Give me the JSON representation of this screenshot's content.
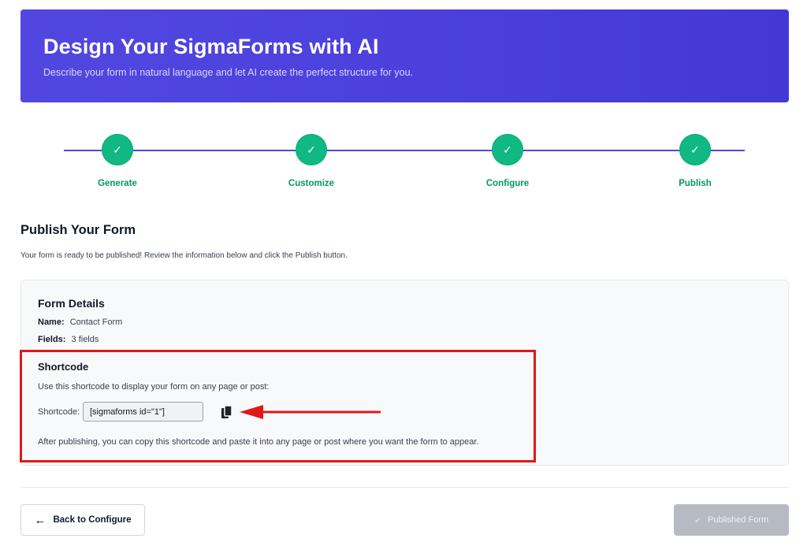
{
  "hero": {
    "title": "Design Your SigmaForms with AI",
    "subtitle": "Describe your form in natural language and let AI create the perfect structure for you."
  },
  "steps": [
    {
      "label": "Generate",
      "status": "completed",
      "icon": "check-icon"
    },
    {
      "label": "Customize",
      "status": "completed",
      "icon": "check-icon"
    },
    {
      "label": "Configure",
      "status": "completed",
      "icon": "check-icon"
    },
    {
      "label": "Publish",
      "status": "completed",
      "icon": "check-icon"
    }
  ],
  "check_glyph": "✓",
  "publish": {
    "title": "Publish Your Form",
    "description": "Your form is ready to be published! Review the information below and click the Publish button."
  },
  "form_details": {
    "title": "Form Details",
    "name_label": "Name:",
    "name_value": "Contact Form",
    "fields_label": "Fields:",
    "fields_value": "3 fields"
  },
  "shortcode": {
    "title": "Shortcode",
    "description": "Use this shortcode to display your form on any page or post:",
    "label": "Shortcode:",
    "value": "[sigmaforms id=\"1\"]",
    "copy_icon": "copy-icon",
    "note": "After publishing, you can copy this shortcode and paste it into any page or post where you want the form to appear."
  },
  "annotation": {
    "highlight_color": "#e01818",
    "arrow_color": "#e01818"
  },
  "buttons": {
    "back_arrow": "←",
    "back_label": "Back to Configure",
    "published_check": "✓",
    "published_label": "Published Form"
  },
  "colors": {
    "hero": "#4f46e5",
    "step_complete": "#10b981",
    "step_line": "#4f46e5",
    "step_label": "#059669",
    "disabled_button": "#b6bac2"
  }
}
